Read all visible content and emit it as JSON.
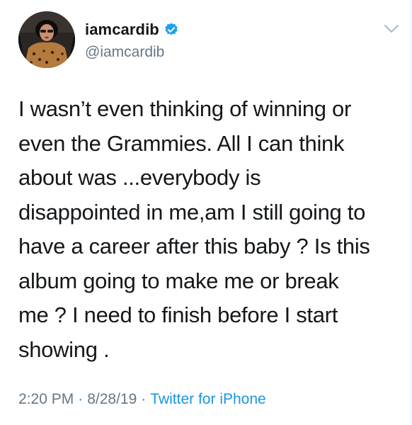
{
  "author": {
    "display_name": "iamcardib",
    "handle": "@iamcardib",
    "verified": true,
    "avatar_icon": "profile-photo"
  },
  "tweet": {
    "text": "I wasn’t even thinking of winning or\neven the Grammies. All I can think\nabout was ...everybody is\ndisappointed in me,am I still going to\nhave a career after this baby ? Is this\nalbum going to make me or break\nme ? I need to finish before I start\nshowing ."
  },
  "meta": {
    "time": "2:20 PM",
    "date": "8/28/19",
    "separator": "·",
    "source": "Twitter for iPhone"
  },
  "colors": {
    "text_primary": "#14171a",
    "text_secondary": "#657786",
    "link_blue": "#1b95e0",
    "verified_blue": "#1da1f2"
  },
  "icons": {
    "verified": "verified-badge-icon",
    "menu": "chevron-down-icon"
  }
}
